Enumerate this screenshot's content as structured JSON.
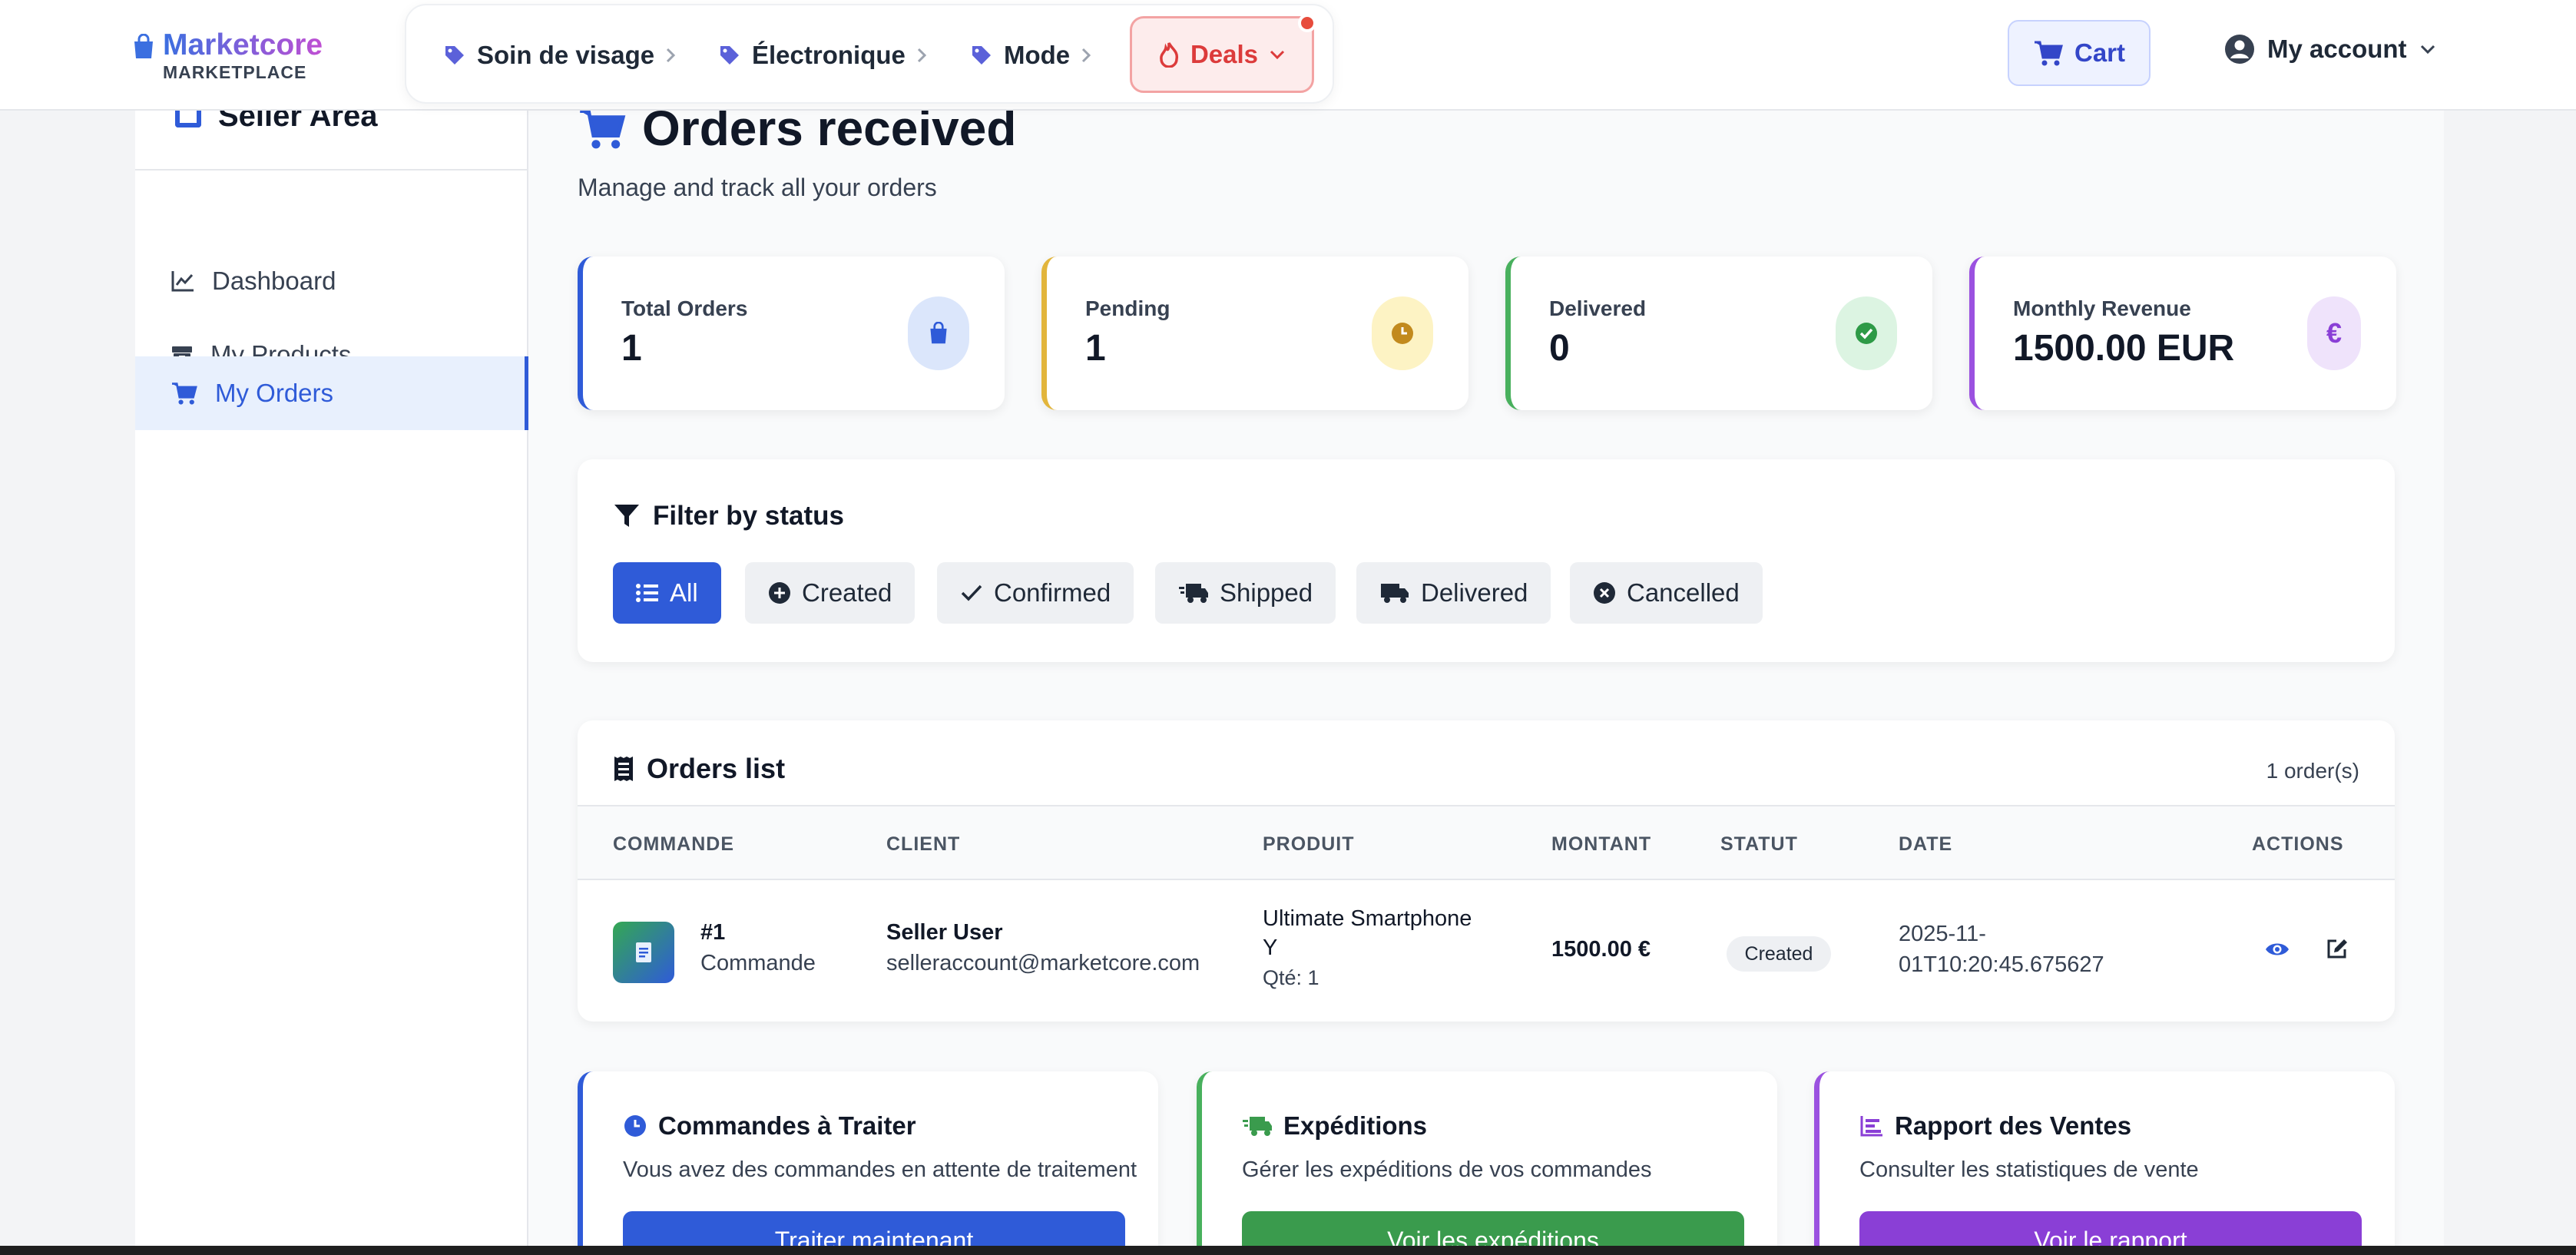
{
  "brand": {
    "name": "Marketcore",
    "sub": "MARKETPLACE"
  },
  "nav": {
    "categories": [
      "Soin de visage",
      "Électronique",
      "Mode"
    ],
    "deals": "Deals",
    "cart": "Cart",
    "account": "My account"
  },
  "sidebar": {
    "title": "Seller Area",
    "items": [
      {
        "label": "Dashboard"
      },
      {
        "label": "My Products"
      },
      {
        "label": "My Orders"
      }
    ]
  },
  "page": {
    "title": "Orders received",
    "subtitle": "Manage and track all your orders"
  },
  "stats": [
    {
      "label": "Total Orders",
      "value": "1"
    },
    {
      "label": "Pending",
      "value": "1"
    },
    {
      "label": "Delivered",
      "value": "0"
    },
    {
      "label": "Monthly Revenue",
      "value": "1500.00 EUR"
    }
  ],
  "colors": {
    "primary": "#2f5bd8",
    "pending": "#e2b53c",
    "delivered": "#48b05d",
    "revenue": "#9b51e0",
    "deals": "#dc3b3b"
  },
  "filter": {
    "title": "Filter by status",
    "chips": [
      "All",
      "Created",
      "Confirmed",
      "Shipped",
      "Delivered",
      "Cancelled"
    ]
  },
  "orders": {
    "title": "Orders list",
    "count": "1 order(s)",
    "columns": [
      "COMMANDE",
      "CLIENT",
      "PRODUIT",
      "MONTANT",
      "STATUT",
      "DATE",
      "ACTIONS"
    ],
    "rows": [
      {
        "id": "#1",
        "kind": "Commande",
        "client_name": "Seller User",
        "client_email": "selleraccount@marketcore.com",
        "product_line1": "Ultimate Smartphone",
        "product_line2": "Y",
        "qty": "Qté: 1",
        "amount": "1500.00 €",
        "status": "Created",
        "date_line1": "2025-11-",
        "date_line2": "01T10:20:45.675627"
      }
    ]
  },
  "actions": [
    {
      "title": "Commandes à Traiter",
      "desc": "Vous avez des commandes en attente de traitement",
      "button": "Traiter maintenant"
    },
    {
      "title": "Expéditions",
      "desc": "Gérer les expéditions de vos commandes",
      "button": "Voir les expéditions"
    },
    {
      "title": "Rapport des Ventes",
      "desc": "Consulter les statistiques de vente",
      "button": "Voir le rapport"
    }
  ]
}
